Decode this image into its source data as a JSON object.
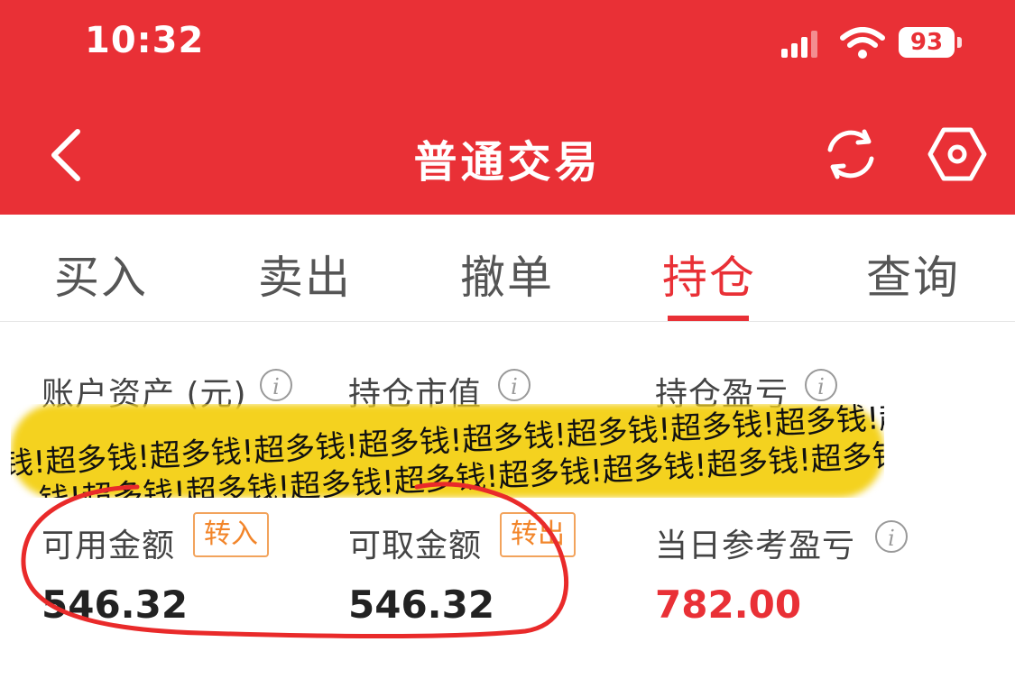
{
  "status_bar": {
    "time": "10:32",
    "battery": "93"
  },
  "header": {
    "title": "普通交易"
  },
  "tabs": [
    {
      "label": "买入"
    },
    {
      "label": "卖出"
    },
    {
      "label": "撤单"
    },
    {
      "label": "持仓",
      "active": true
    },
    {
      "label": "查询"
    }
  ],
  "summary": {
    "account_assets_label": "账户资产 (元)",
    "position_value_label": "持仓市值",
    "position_pnl_label": "持仓盈亏"
  },
  "overlay": {
    "text_row": "钱!超多钱!超多钱!超多钱!超多钱!超多钱!超多钱!超多钱!超多钱!超多"
  },
  "funds": {
    "available_label": "可用金额",
    "transfer_in_label": "转入",
    "withdrawable_label": "可取金额",
    "transfer_out_label": "转出",
    "daily_pnl_label": "当日参考盈亏",
    "available_value": "546.32",
    "withdrawable_value": "546.32",
    "daily_pnl_value": "782.00"
  },
  "colors": {
    "brand_red": "#e93036",
    "accent_orange": "#f2852a",
    "mask_yellow": "#f4d21f"
  },
  "icons": [
    "back-icon",
    "refresh-icon",
    "settings-icon",
    "info-icon",
    "signal-icon",
    "wifi-icon",
    "battery-icon"
  ]
}
